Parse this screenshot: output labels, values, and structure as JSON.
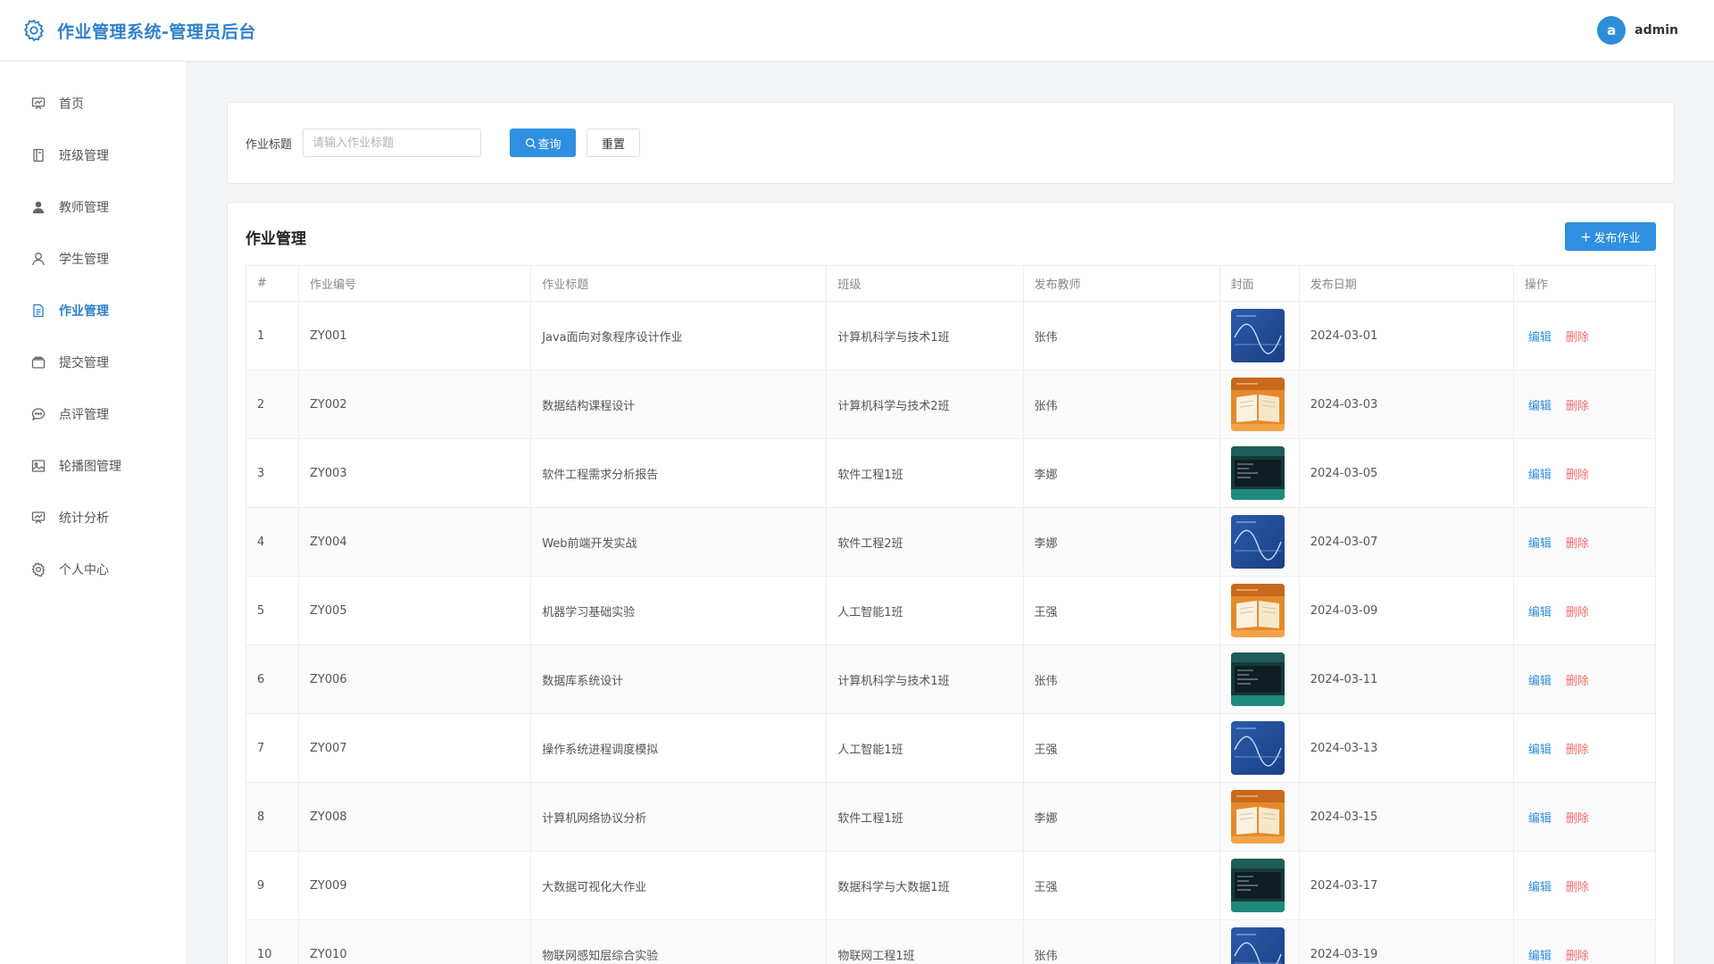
{
  "header": {
    "title": "作业管理系统-管理员后台",
    "avatar_letter": "a",
    "username": "admin"
  },
  "colors": {
    "brand": "#2f80c9",
    "primary": "#2f8fe0",
    "danger": "#f56c6c"
  },
  "sidebar": {
    "items": [
      {
        "label": "首页",
        "icon": "chart-board-icon"
      },
      {
        "label": "班级管理",
        "icon": "book-icon"
      },
      {
        "label": "教师管理",
        "icon": "user-filled-icon"
      },
      {
        "label": "学生管理",
        "icon": "user-icon"
      },
      {
        "label": "作业管理",
        "icon": "document-icon",
        "active": true
      },
      {
        "label": "提交管理",
        "icon": "wallet-icon"
      },
      {
        "label": "点评管理",
        "icon": "chat-icon"
      },
      {
        "label": "轮播图管理",
        "icon": "picture-icon"
      },
      {
        "label": "统计分析",
        "icon": "chart-board-icon"
      },
      {
        "label": "个人中心",
        "icon": "gear-icon"
      }
    ]
  },
  "search": {
    "label": "作业标题",
    "placeholder": "请输入作业标题",
    "query_label": "查询",
    "reset_label": "重置"
  },
  "table": {
    "title": "作业管理",
    "publish_label": "发布作业",
    "columns": [
      "#",
      "作业编号",
      "作业标题",
      "班级",
      "发布教师",
      "封面",
      "发布日期",
      "操作"
    ],
    "edit_label": "编辑",
    "delete_label": "删除",
    "rows": [
      {
        "no": "1",
        "code": "ZY001",
        "title": "Java面向对象程序设计作业",
        "class": "计算机科学与技术1班",
        "teacher": "张伟",
        "cover": "wave",
        "date": "2024-03-01"
      },
      {
        "no": "2",
        "code": "ZY002",
        "title": "数据结构课程设计",
        "class": "计算机科学与技术2班",
        "teacher": "张伟",
        "cover": "book",
        "date": "2024-03-03"
      },
      {
        "no": "3",
        "code": "ZY003",
        "title": "软件工程需求分析报告",
        "class": "软件工程1班",
        "teacher": "李娜",
        "cover": "code",
        "date": "2024-03-05"
      },
      {
        "no": "4",
        "code": "ZY004",
        "title": "Web前端开发实战",
        "class": "软件工程2班",
        "teacher": "李娜",
        "cover": "wave",
        "date": "2024-03-07"
      },
      {
        "no": "5",
        "code": "ZY005",
        "title": "机器学习基础实验",
        "class": "人工智能1班",
        "teacher": "王强",
        "cover": "book",
        "date": "2024-03-09"
      },
      {
        "no": "6",
        "code": "ZY006",
        "title": "数据库系统设计",
        "class": "计算机科学与技术1班",
        "teacher": "张伟",
        "cover": "code",
        "date": "2024-03-11"
      },
      {
        "no": "7",
        "code": "ZY007",
        "title": "操作系统进程调度模拟",
        "class": "人工智能1班",
        "teacher": "王强",
        "cover": "wave",
        "date": "2024-03-13"
      },
      {
        "no": "8",
        "code": "ZY008",
        "title": "计算机网络协议分析",
        "class": "软件工程1班",
        "teacher": "李娜",
        "cover": "book",
        "date": "2024-03-15"
      },
      {
        "no": "9",
        "code": "ZY009",
        "title": "大数据可视化大作业",
        "class": "数据科学与大数据1班",
        "teacher": "王强",
        "cover": "code",
        "date": "2024-03-17"
      },
      {
        "no": "10",
        "code": "ZY010",
        "title": "物联网感知层综合实验",
        "class": "物联网工程1班",
        "teacher": "张伟",
        "cover": "wave",
        "date": "2024-03-19"
      }
    ]
  }
}
